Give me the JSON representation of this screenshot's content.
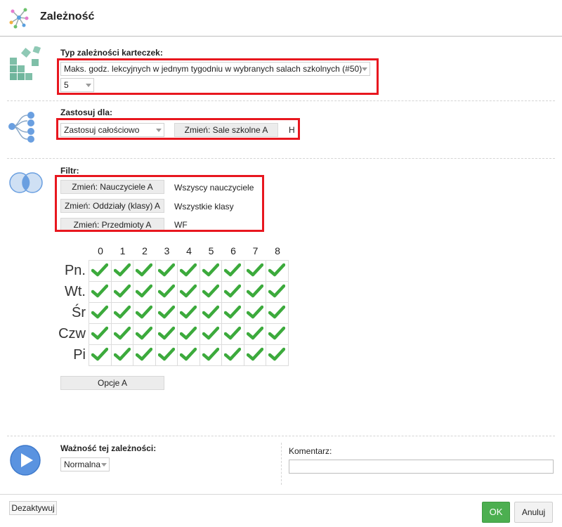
{
  "header": {
    "title": "Zależność",
    "icon": "network-graph-icon"
  },
  "card_type": {
    "label": "Typ zależności karteczek:",
    "select_value": "Maks. godz. lekcyjnych w jednym tygodniu w wybranych salach szkolnych (#50)",
    "number_value": "5",
    "icon": "blocks-icon"
  },
  "apply": {
    "label": "Zastosuj dla:",
    "select_value": "Zastosuj całościowo",
    "change_button": "Zmień: Sale szkolne A",
    "value": "H",
    "icon": "tree-icon"
  },
  "filter": {
    "label": "Filtr:",
    "icon": "venn-icon",
    "rows": [
      {
        "button": "Zmień: Nauczyciele A",
        "value": "Wszyscy nauczyciele"
      },
      {
        "button": "Zmień: Oddziały (klasy) A",
        "value": "Wszystkie klasy"
      },
      {
        "button": "Zmień: Przedmioty A",
        "value": "WF"
      }
    ]
  },
  "timetable": {
    "periods": [
      "0",
      "1",
      "2",
      "3",
      "4",
      "5",
      "6",
      "7",
      "8"
    ],
    "days": [
      "Pn.",
      "Wt.",
      "Śr",
      "Czw",
      "Pi"
    ],
    "cells": [
      [
        true,
        true,
        true,
        true,
        true,
        true,
        true,
        true,
        true
      ],
      [
        true,
        true,
        true,
        true,
        true,
        true,
        true,
        true,
        true
      ],
      [
        true,
        true,
        true,
        true,
        true,
        true,
        true,
        true,
        true
      ],
      [
        true,
        true,
        true,
        true,
        true,
        true,
        true,
        true,
        true
      ],
      [
        true,
        true,
        true,
        true,
        true,
        true,
        true,
        true,
        true
      ]
    ],
    "check_color": "#3caa3c",
    "options_button": "Opcje A"
  },
  "importance": {
    "label": "Ważność tej zależności:",
    "select_value": "Normalna",
    "icon": "play-icon"
  },
  "comment": {
    "label": "Komentarz:",
    "value": ""
  },
  "footer": {
    "deactivate": "Dezaktywuj",
    "ok": "OK",
    "cancel": "Anuluj"
  },
  "colors": {
    "highlight": "#e8171f",
    "ok": "#4caf50",
    "icon_blue": "#6a9fe0"
  }
}
